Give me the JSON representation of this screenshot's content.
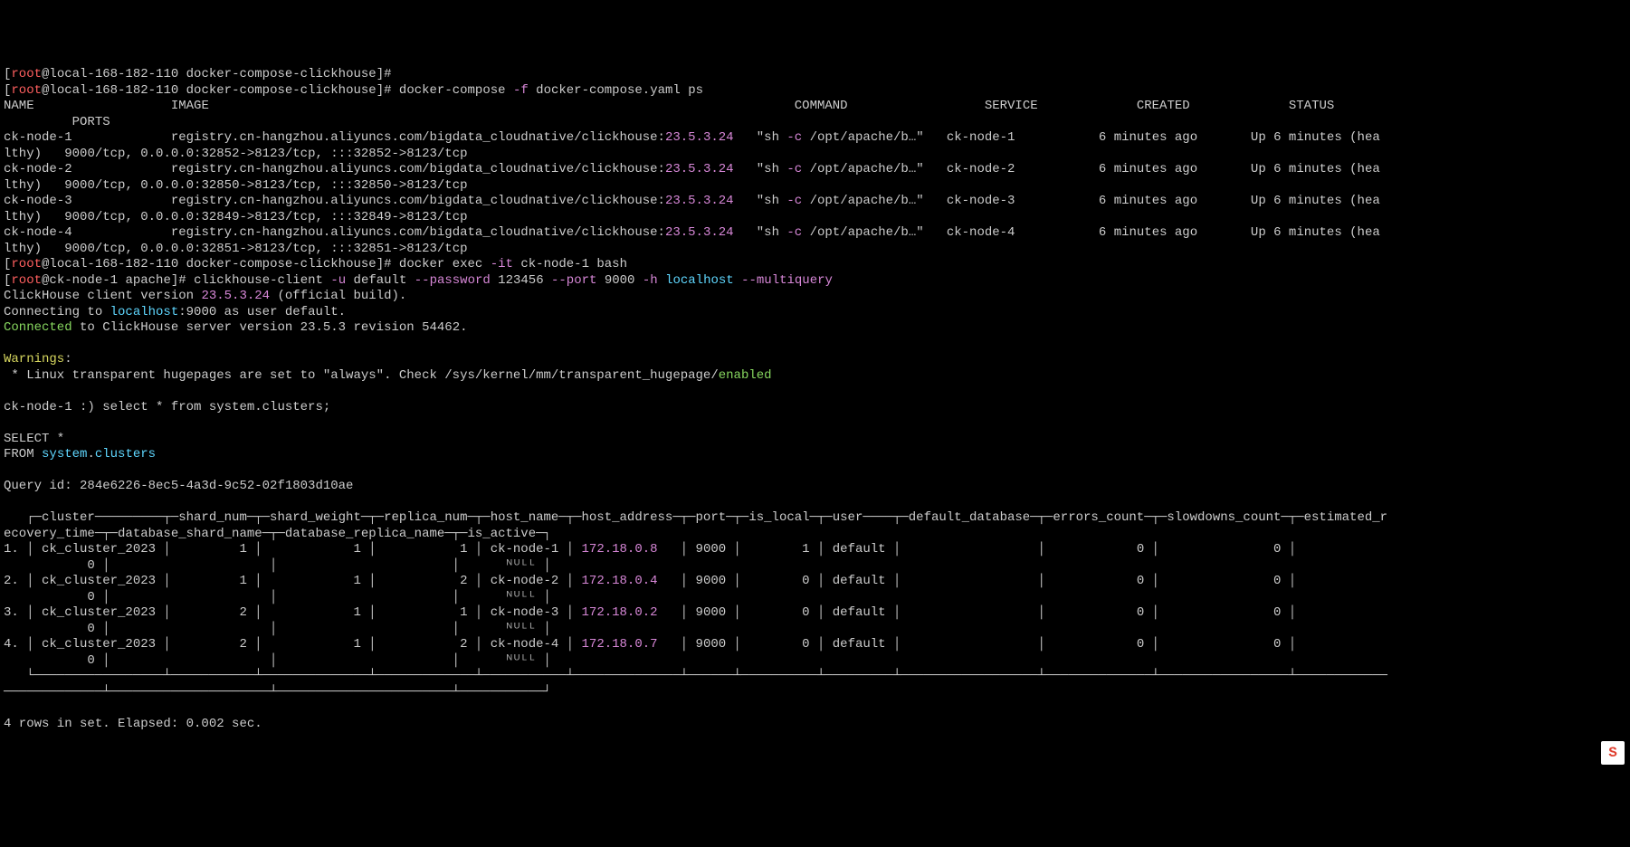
{
  "prompt1_user": "root",
  "prompt1_host": "local-168-182-110",
  "prompt1_dir": "docker-compose-clickhouse",
  "cmd_dcps": "docker-compose ",
  "dcps_flag": "-f",
  "dcps_file": " docker-compose.yaml ps",
  "hdr_name": "NAME",
  "hdr_image": "IMAGE",
  "hdr_command": "COMMAND",
  "hdr_service": "SERVICE",
  "hdr_created": "CREATED",
  "hdr_status": "STATUS",
  "hdr_ports": "PORTS",
  "rows": [
    {
      "name": "ck-node-1",
      "image": "registry.cn-hangzhou.aliyuncs.com/bigdata_cloudnative/clickhouse:",
      "tag": "23.5.3.24",
      "cmd_q": "\"sh ",
      "cmd_f": "-c",
      "cmd_r": " /opt/apache/b…\"",
      "svc": "ck-node-1",
      "created": "6 minutes ago",
      "status": "Up 6 minutes (hea",
      "status2": "lthy)",
      "ports": "9000/tcp, 0.0.0.0:32852->8123/tcp, :::32852->8123/tcp"
    },
    {
      "name": "ck-node-2",
      "image": "registry.cn-hangzhou.aliyuncs.com/bigdata_cloudnative/clickhouse:",
      "tag": "23.5.3.24",
      "cmd_q": "\"sh ",
      "cmd_f": "-c",
      "cmd_r": " /opt/apache/b…\"",
      "svc": "ck-node-2",
      "created": "6 minutes ago",
      "status": "Up 6 minutes (hea",
      "status2": "lthy)",
      "ports": "9000/tcp, 0.0.0.0:32850->8123/tcp, :::32850->8123/tcp"
    },
    {
      "name": "ck-node-3",
      "image": "registry.cn-hangzhou.aliyuncs.com/bigdata_cloudnative/clickhouse:",
      "tag": "23.5.3.24",
      "cmd_q": "\"sh ",
      "cmd_f": "-c",
      "cmd_r": " /opt/apache/b…\"",
      "svc": "ck-node-3",
      "created": "6 minutes ago",
      "status": "Up 6 minutes (hea",
      "status2": "lthy)",
      "ports": "9000/tcp, 0.0.0.0:32849->8123/tcp, :::32849->8123/tcp"
    },
    {
      "name": "ck-node-4",
      "image": "registry.cn-hangzhou.aliyuncs.com/bigdata_cloudnative/clickhouse:",
      "tag": "23.5.3.24",
      "cmd_q": "\"sh ",
      "cmd_f": "-c",
      "cmd_r": " /opt/apache/b…\"",
      "svc": "ck-node-4",
      "created": "6 minutes ago",
      "status": "Up 6 minutes (hea",
      "status2": "lthy)",
      "ports": "9000/tcp, 0.0.0.0:32851->8123/tcp, :::32851->8123/tcp"
    }
  ],
  "cmd2_a": "docker exec ",
  "cmd2_it": "-it",
  "cmd2_b": " ck-node-1 bash",
  "p3_user": "root",
  "p3_host": "ck-node-1",
  "p3_dir": "apache",
  "cmd3_a": "clickhouse-client ",
  "cmd3_u": "-u",
  "cmd3_b": " default ",
  "cmd3_pw": "--password",
  "cmd3_c": " 123456 ",
  "cmd3_port": "--port",
  "cmd3_d": " 9000 ",
  "cmd3_h": "-h",
  "cmd3_e": " ",
  "cmd3_host": "localhost",
  "cmd3_f": " ",
  "cmd3_mq": "--multiquery",
  "cli_ver_a": "ClickHouse client version ",
  "cli_ver_b": "23.5.3.24",
  "cli_ver_c": " (official build).",
  "conn_a": "Connecting to ",
  "conn_b": "localhost",
  "conn_c": ":9000 as user default.",
  "connd_a": "Connected",
  "connd_b": " to ClickHouse server version 23.5.3 revision 54462.",
  "warn_a": "Warnings",
  "warn_b": ":",
  "warn_c": " * Linux transparent hugepages are set to \"always\". Check /sys/kernel/mm/transparent_hugepage/",
  "warn_d": "enabled",
  "qprompt": "ck-node-1 :) select * from system.clusters;",
  "sel": "SELECT *",
  "frm_a": "FROM ",
  "frm_b": "system",
  "frm_c": ".",
  "frm_d": "clusters",
  "qid": "Query id: 284e6226-8ec5-4a3d-9c52-02f1803d10ae",
  "thead1": "   ┌─cluster─────────┬─shard_num─┬─shard_weight─┬─replica_num─┬─host_name─┬─host_address─┬─port─┬─is_local─┬─user────┬─default_database─┬─errors_count─┬─slowdowns_count─┬─estimated_r",
  "thead2": "ecovery_time─┬─database_shard_name─┬─database_replica_name─┬─is_active─┐",
  "trow1a": "1. │ ck_cluster_2023 │         1 │            1 │           1 │ ck-node-1 │ ",
  "trow1ip": "172.18.0.8",
  "trow1b": "   │ 9000 │        1 │ default │                  │            0 │               0 │",
  "trow1c": "           0 │                     │                       │      ",
  "trow1n": "ᴺᵁᴸᴸ",
  "trow1d": " │",
  "trow2a": "2. │ ck_cluster_2023 │         1 │            1 │           2 │ ck-node-2 │ ",
  "trow2ip": "172.18.0.4",
  "trow2b": "   │ 9000 │        0 │ default │                  │            0 │               0 │",
  "trow2c": "           0 │                     │                       │      ",
  "trow2n": "ᴺᵁᴸᴸ",
  "trow2d": " │",
  "trow3a": "3. │ ck_cluster_2023 │         2 │            1 │           1 │ ck-node-3 │ ",
  "trow3ip": "172.18.0.2",
  "trow3b": "   │ 9000 │        0 │ default │                  │            0 │               0 │",
  "trow3c": "           0 │                     │                       │      ",
  "trow3n": "ᴺᵁᴸᴸ",
  "trow3d": " │",
  "trow4a": "4. │ ck_cluster_2023 │         2 │            1 │           2 │ ck-node-4 │ ",
  "trow4ip": "172.18.0.7",
  "trow4b": "   │ 9000 │        0 │ default │                  │            0 │               0 │",
  "trow4c": "           0 │                     │                       │      ",
  "trow4n": "ᴺᵁᴸᴸ",
  "trow4d": " │",
  "tfoot1": "   └─────────────────┴───────────┴──────────────┴─────────────┴───────────┴──────────────┴──────┴──────────┴─────────┴──────────────────┴──────────────┴─────────────────┴────────────",
  "tfoot2": "─────────────┴─────────────────────┴───────────────────────┴───────────┘",
  "summary": "4 rows in set. Elapsed: 0.002 sec.",
  "chart_data": {
    "type": "table",
    "title": "system.clusters",
    "columns": [
      "cluster",
      "shard_num",
      "shard_weight",
      "replica_num",
      "host_name",
      "host_address",
      "port",
      "is_local",
      "user",
      "default_database",
      "errors_count",
      "slowdowns_count",
      "estimated_recovery_time",
      "database_shard_name",
      "database_replica_name",
      "is_active"
    ],
    "rows": [
      [
        "ck_cluster_2023",
        1,
        1,
        1,
        "ck-node-1",
        "172.18.0.8",
        9000,
        1,
        "default",
        "",
        0,
        0,
        0,
        "",
        "",
        null
      ],
      [
        "ck_cluster_2023",
        1,
        1,
        2,
        "ck-node-2",
        "172.18.0.4",
        9000,
        0,
        "default",
        "",
        0,
        0,
        0,
        "",
        "",
        null
      ],
      [
        "ck_cluster_2023",
        2,
        1,
        1,
        "ck-node-3",
        "172.18.0.2",
        9000,
        0,
        "default",
        "",
        0,
        0,
        0,
        "",
        "",
        null
      ],
      [
        "ck_cluster_2023",
        2,
        1,
        2,
        "ck-node-4",
        "172.18.0.7",
        9000,
        0,
        "default",
        "",
        0,
        0,
        0,
        "",
        "",
        null
      ]
    ]
  }
}
